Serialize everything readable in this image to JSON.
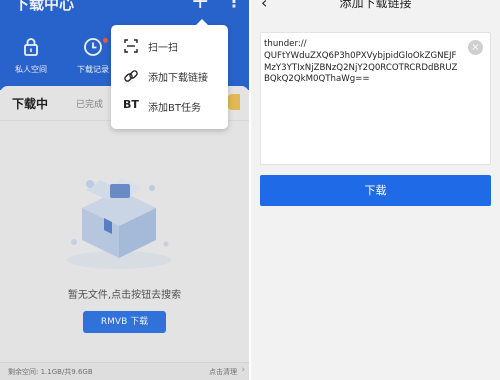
{
  "left": {
    "title": "下载中心",
    "plus": "+",
    "dots": "⋮",
    "quick_actions": [
      {
        "label": "私人空间",
        "icon": "lock-icon"
      },
      {
        "label": "下载记录",
        "icon": "clock-icon"
      }
    ],
    "tabs": {
      "active": "下载中",
      "done": "已完成"
    },
    "empty_text": "暂无文件,点击按钮去搜索",
    "rmvb_button": "RMVB 下载",
    "storage": "剩余空间: 1.1GB/共9.6GB",
    "clean": "点击清理",
    "chevron": "›"
  },
  "popup": {
    "items": [
      {
        "label": "扫一扫",
        "icon": "scan-icon"
      },
      {
        "label": "添加下载链接",
        "icon": "link-icon"
      },
      {
        "label": "添加BT任务",
        "icon": "bt-icon",
        "glyph": "BT"
      }
    ]
  },
  "right": {
    "back": "‹",
    "title": "添加下载链接",
    "link_text": "thunder://\nQUFtYWduZXQ6P3h0PXVybjpidGloOkZGNEJFMzY3YTIxNjZBNzQ2NjY2Q0RCOTRCRDdBRUZBQkQ2QkM0QThaWg==",
    "clear": "×",
    "download_button": "下载"
  },
  "colors": {
    "brand_blue": "#2b6ad9",
    "button_blue": "#1f6ae6"
  }
}
